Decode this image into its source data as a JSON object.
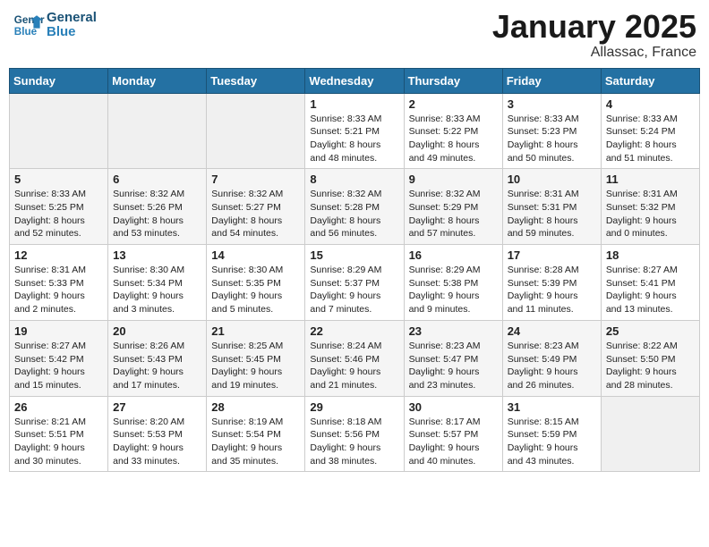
{
  "logo": {
    "line1": "General",
    "line2": "Blue"
  },
  "title": "January 2025",
  "location": "Allassac, France",
  "weekdays": [
    "Sunday",
    "Monday",
    "Tuesday",
    "Wednesday",
    "Thursday",
    "Friday",
    "Saturday"
  ],
  "weeks": [
    [
      {
        "day": null,
        "info": null
      },
      {
        "day": null,
        "info": null
      },
      {
        "day": null,
        "info": null
      },
      {
        "day": "1",
        "info": "Sunrise: 8:33 AM\nSunset: 5:21 PM\nDaylight: 8 hours\nand 48 minutes."
      },
      {
        "day": "2",
        "info": "Sunrise: 8:33 AM\nSunset: 5:22 PM\nDaylight: 8 hours\nand 49 minutes."
      },
      {
        "day": "3",
        "info": "Sunrise: 8:33 AM\nSunset: 5:23 PM\nDaylight: 8 hours\nand 50 minutes."
      },
      {
        "day": "4",
        "info": "Sunrise: 8:33 AM\nSunset: 5:24 PM\nDaylight: 8 hours\nand 51 minutes."
      }
    ],
    [
      {
        "day": "5",
        "info": "Sunrise: 8:33 AM\nSunset: 5:25 PM\nDaylight: 8 hours\nand 52 minutes."
      },
      {
        "day": "6",
        "info": "Sunrise: 8:32 AM\nSunset: 5:26 PM\nDaylight: 8 hours\nand 53 minutes."
      },
      {
        "day": "7",
        "info": "Sunrise: 8:32 AM\nSunset: 5:27 PM\nDaylight: 8 hours\nand 54 minutes."
      },
      {
        "day": "8",
        "info": "Sunrise: 8:32 AM\nSunset: 5:28 PM\nDaylight: 8 hours\nand 56 minutes."
      },
      {
        "day": "9",
        "info": "Sunrise: 8:32 AM\nSunset: 5:29 PM\nDaylight: 8 hours\nand 57 minutes."
      },
      {
        "day": "10",
        "info": "Sunrise: 8:31 AM\nSunset: 5:31 PM\nDaylight: 8 hours\nand 59 minutes."
      },
      {
        "day": "11",
        "info": "Sunrise: 8:31 AM\nSunset: 5:32 PM\nDaylight: 9 hours\nand 0 minutes."
      }
    ],
    [
      {
        "day": "12",
        "info": "Sunrise: 8:31 AM\nSunset: 5:33 PM\nDaylight: 9 hours\nand 2 minutes."
      },
      {
        "day": "13",
        "info": "Sunrise: 8:30 AM\nSunset: 5:34 PM\nDaylight: 9 hours\nand 3 minutes."
      },
      {
        "day": "14",
        "info": "Sunrise: 8:30 AM\nSunset: 5:35 PM\nDaylight: 9 hours\nand 5 minutes."
      },
      {
        "day": "15",
        "info": "Sunrise: 8:29 AM\nSunset: 5:37 PM\nDaylight: 9 hours\nand 7 minutes."
      },
      {
        "day": "16",
        "info": "Sunrise: 8:29 AM\nSunset: 5:38 PM\nDaylight: 9 hours\nand 9 minutes."
      },
      {
        "day": "17",
        "info": "Sunrise: 8:28 AM\nSunset: 5:39 PM\nDaylight: 9 hours\nand 11 minutes."
      },
      {
        "day": "18",
        "info": "Sunrise: 8:27 AM\nSunset: 5:41 PM\nDaylight: 9 hours\nand 13 minutes."
      }
    ],
    [
      {
        "day": "19",
        "info": "Sunrise: 8:27 AM\nSunset: 5:42 PM\nDaylight: 9 hours\nand 15 minutes."
      },
      {
        "day": "20",
        "info": "Sunrise: 8:26 AM\nSunset: 5:43 PM\nDaylight: 9 hours\nand 17 minutes."
      },
      {
        "day": "21",
        "info": "Sunrise: 8:25 AM\nSunset: 5:45 PM\nDaylight: 9 hours\nand 19 minutes."
      },
      {
        "day": "22",
        "info": "Sunrise: 8:24 AM\nSunset: 5:46 PM\nDaylight: 9 hours\nand 21 minutes."
      },
      {
        "day": "23",
        "info": "Sunrise: 8:23 AM\nSunset: 5:47 PM\nDaylight: 9 hours\nand 23 minutes."
      },
      {
        "day": "24",
        "info": "Sunrise: 8:23 AM\nSunset: 5:49 PM\nDaylight: 9 hours\nand 26 minutes."
      },
      {
        "day": "25",
        "info": "Sunrise: 8:22 AM\nSunset: 5:50 PM\nDaylight: 9 hours\nand 28 minutes."
      }
    ],
    [
      {
        "day": "26",
        "info": "Sunrise: 8:21 AM\nSunset: 5:51 PM\nDaylight: 9 hours\nand 30 minutes."
      },
      {
        "day": "27",
        "info": "Sunrise: 8:20 AM\nSunset: 5:53 PM\nDaylight: 9 hours\nand 33 minutes."
      },
      {
        "day": "28",
        "info": "Sunrise: 8:19 AM\nSunset: 5:54 PM\nDaylight: 9 hours\nand 35 minutes."
      },
      {
        "day": "29",
        "info": "Sunrise: 8:18 AM\nSunset: 5:56 PM\nDaylight: 9 hours\nand 38 minutes."
      },
      {
        "day": "30",
        "info": "Sunrise: 8:17 AM\nSunset: 5:57 PM\nDaylight: 9 hours\nand 40 minutes."
      },
      {
        "day": "31",
        "info": "Sunrise: 8:15 AM\nSunset: 5:59 PM\nDaylight: 9 hours\nand 43 minutes."
      },
      {
        "day": null,
        "info": null
      }
    ]
  ]
}
